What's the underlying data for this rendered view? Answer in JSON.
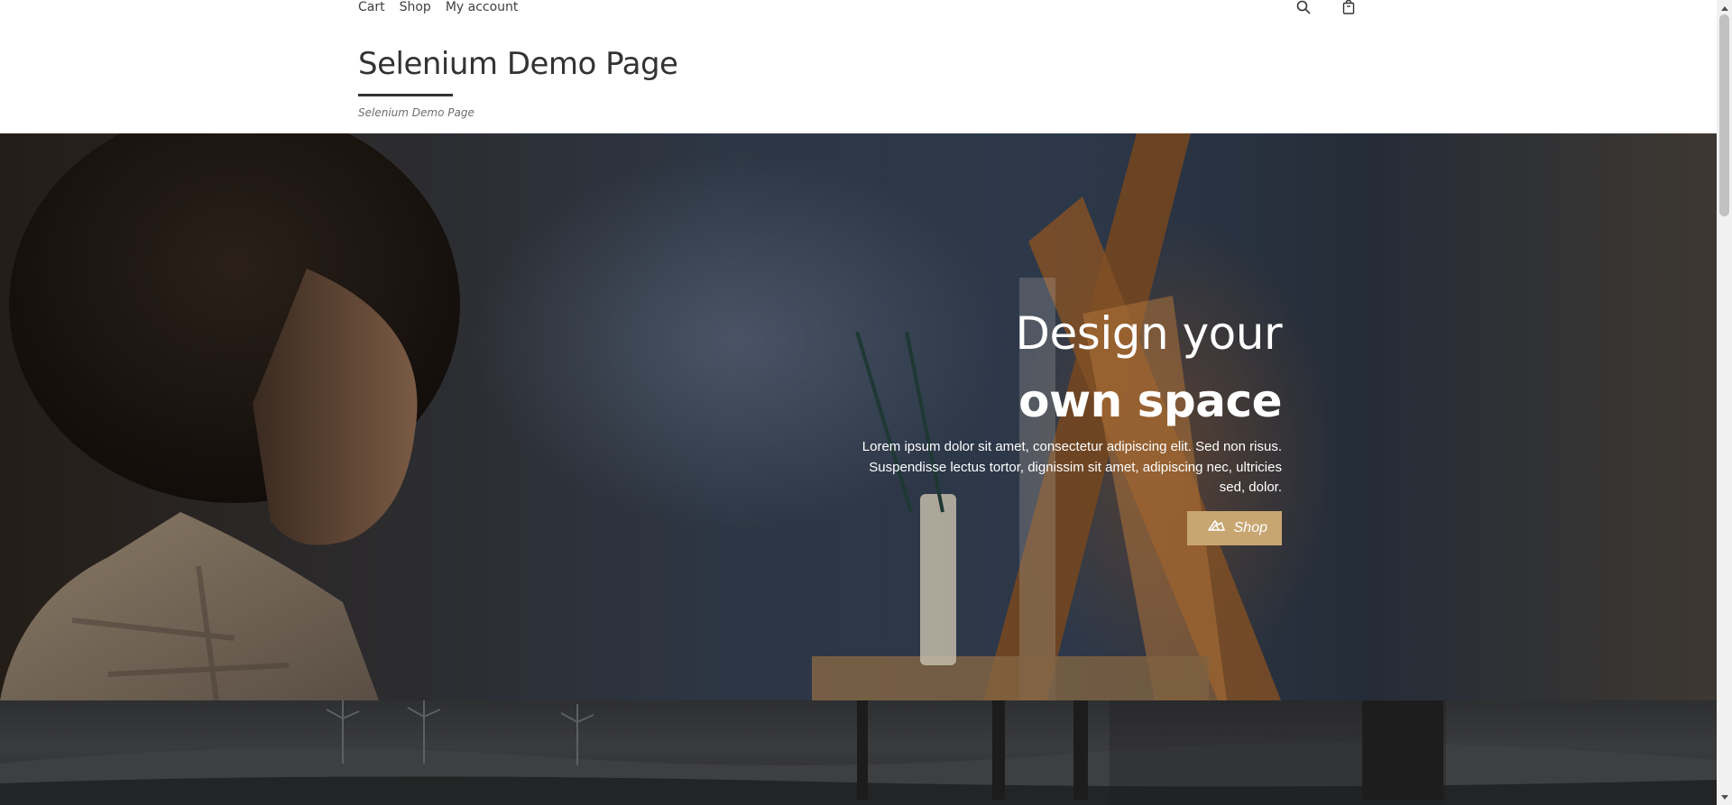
{
  "nav": {
    "links": [
      "Cart",
      "Shop",
      "My account"
    ],
    "search_icon": "search-icon",
    "bag_icon": "shopping-bag-icon"
  },
  "header": {
    "title": "Selenium Demo Page",
    "tagline": "Selenium Demo Page"
  },
  "hero": {
    "heading_line1": "Design your",
    "heading_line2": "own space",
    "text": "Lorem ipsum dolor sit amet, consectetur adipiscing elit. Sed non risus. Suspendisse lectus tortor, dignissim sit amet, adipiscing nec, ultricies sed, dolor.",
    "button_label": "Shop",
    "button_icon": "shop-logo-icon"
  },
  "colors": {
    "accent": "#c8a672",
    "text": "#333333"
  }
}
